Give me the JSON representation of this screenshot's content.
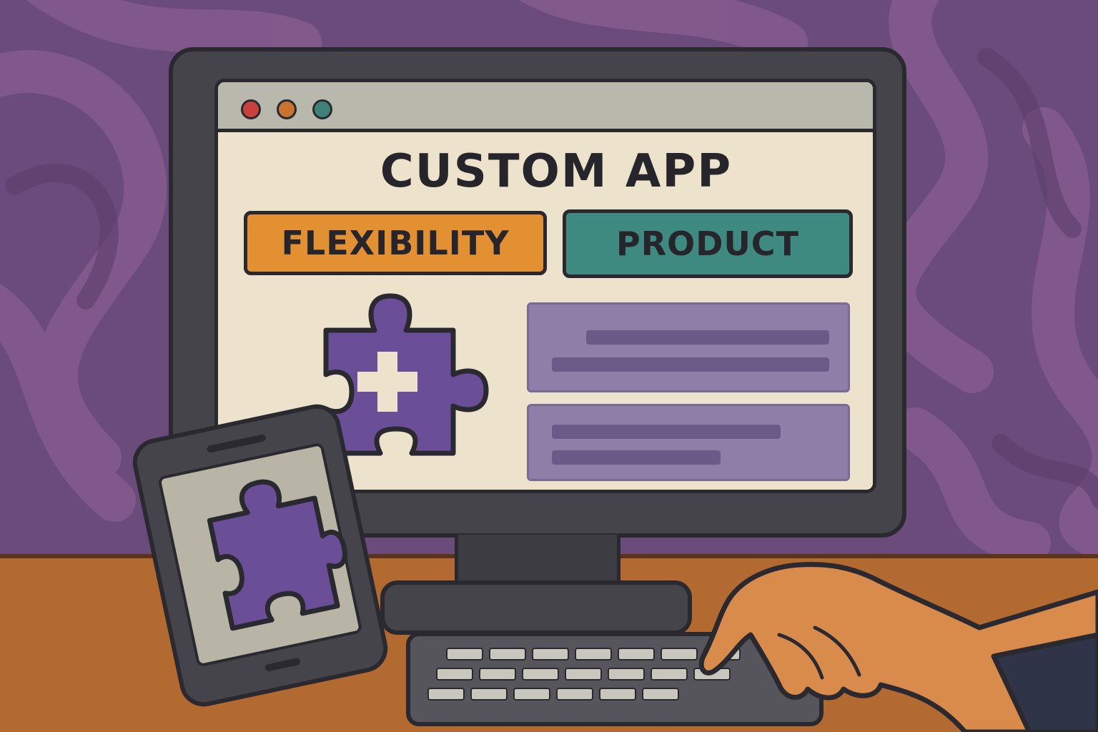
{
  "window": {
    "controls": [
      "close-dot",
      "minimize-dot",
      "maximize-dot"
    ]
  },
  "app": {
    "title": "CUSTOM APP"
  },
  "tags": {
    "flexibility": "FLEXIBILITY",
    "product": "PRODUCT"
  },
  "icons": {
    "main": "puzzle-piece-plus-icon",
    "phone": "puzzle-piece-icon"
  },
  "colors": {
    "background": "#6b4a7c",
    "accent_orange": "#e39033",
    "accent_teal": "#3f8a80",
    "puzzle_purple": "#6a4e98",
    "screen": "#ede3cc",
    "desk": "#b36a30"
  }
}
